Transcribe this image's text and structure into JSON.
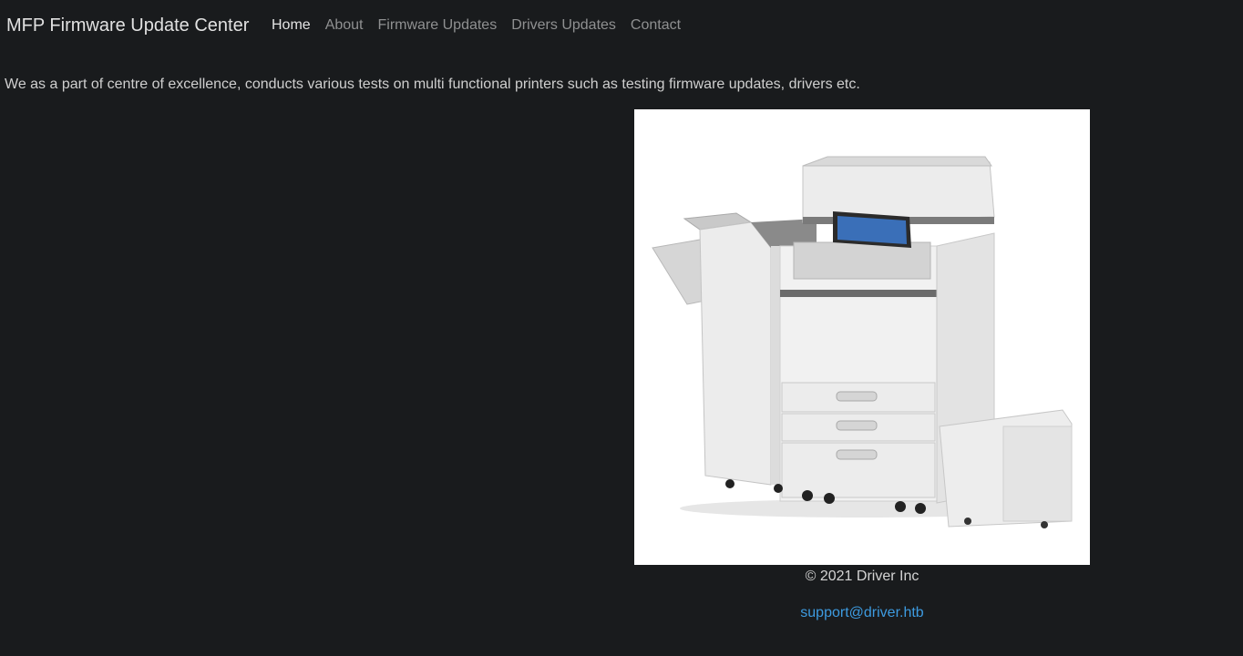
{
  "nav": {
    "brand": "MFP Firmware Update Center",
    "links": [
      {
        "label": "Home",
        "active": true
      },
      {
        "label": "About"
      },
      {
        "label": "Firmware Updates"
      },
      {
        "label": "Drivers Updates"
      },
      {
        "label": "Contact"
      }
    ]
  },
  "main": {
    "intro": "We as a part of centre of excellence, conducts various tests on multi functional printers such as testing firmware updates, drivers etc.",
    "hero_image": "multifunction-printer-image"
  },
  "footer": {
    "copyright": "© 2021 Driver Inc",
    "email": "support@driver.htb"
  },
  "colors": {
    "background": "#191b1d",
    "link": "#3d9be0",
    "nav_muted": "#8f9091"
  }
}
